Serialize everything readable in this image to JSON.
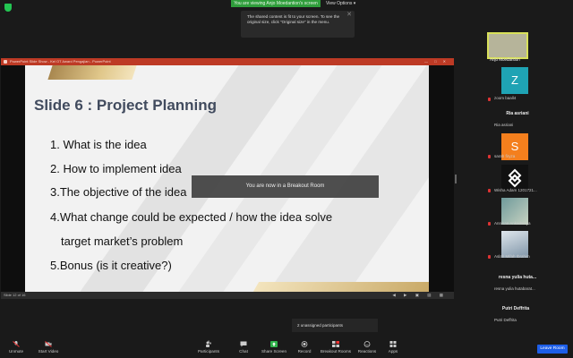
{
  "top": {
    "banner": "You are viewing Anjo Moedantion's screen",
    "view_options": "View Options",
    "view_options_caret": "▾",
    "tooltip": "The shared content is fit to your screen. To see the original size, click \"Original size\" in the menu.",
    "tooltip_close": "✕"
  },
  "shared_window": {
    "title": "PowerPoint Slide Show - Kel OT Award Pengajian - PowerPoint",
    "controls": "— □ ✕",
    "slide_counter": "Slide 12 of 16",
    "nav_controls": "◀ ▶ ▣ ▤ ▦"
  },
  "slide": {
    "title": "Slide 6 : Project Planning",
    "items": [
      "1. What is the idea",
      "2. How to implement idea",
      "3.The objective of the idea",
      "4.What change could be expected / how the idea solve",
      "target market’s problem",
      "5.Bonus (is it creative?)"
    ]
  },
  "breakout_notice": "You are now in a Breakout Room",
  "unassigned": "2 unassigned participants",
  "participants": [
    {
      "name": "Anjo Moedantion",
      "kind": "video",
      "color": "#b6b49a"
    },
    {
      "name": "zoom baall4",
      "kind": "letter",
      "letter": "Z",
      "color": "#1fa3b4"
    },
    {
      "name": "Ria asriani",
      "kind": "text"
    },
    {
      "name": "Ria asriani",
      "kind": "label"
    },
    {
      "name": "sarah firyza",
      "kind": "letter",
      "letter": "S",
      "color": "#f47f1d"
    },
    {
      "name": "Wisha Adam 1201721...",
      "kind": "logo",
      "color": "#111111"
    },
    {
      "name": "Annisaa Ankadsioya",
      "kind": "video",
      "color": "#7fa5a6"
    },
    {
      "name": "Aslah Mifah Ibrahim",
      "kind": "video",
      "color": "#a9b8c4"
    },
    {
      "name": "resna yulia huta...",
      "kind": "text"
    },
    {
      "name": "resna yulia hutabarat...",
      "kind": "label"
    },
    {
      "name": "Putri Deffrita",
      "kind": "text"
    },
    {
      "name": "Putri Deffrita",
      "kind": "label"
    }
  ],
  "toolbar": {
    "unmute": "Unmute",
    "start_video": "Start Video",
    "participants": "Participants",
    "participants_count": "9",
    "chat": "Chat",
    "share_screen": "Share Screen",
    "record": "Record",
    "breakout_rooms": "Breakout Rooms",
    "reactions": "Reactions",
    "apps": "Apps",
    "leave_room": "Leave Room"
  },
  "colors": {
    "share_green": "#2f9e3b",
    "window_titlebar": "#bd3a25",
    "leave_blue": "#1d5ee8",
    "slide_title": "#414b5e",
    "gold": "#c8a865"
  }
}
